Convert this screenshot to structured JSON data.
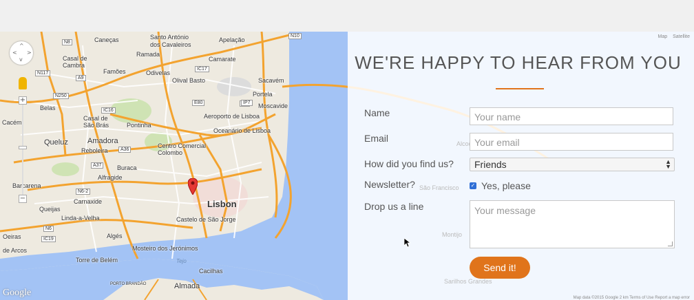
{
  "map": {
    "labels": {
      "santo_antonio": "Santo António",
      "cavaleiros": "dos Cavaleiros",
      "caneças": "Caneças",
      "apelacao": "Apelação",
      "ramada": "Ramada",
      "camarate": "Camarate",
      "casal_cambra": "Casal de",
      "cambra": "Cambra",
      "famoes": "Famões",
      "odivelas": "Odivelas",
      "olival_basto": "Olival Basto",
      "sacavem": "Sacavém",
      "portela": "Portela",
      "belas": "Belas",
      "aeroporto": "Aeroporto de Lisboa",
      "moscavide": "Moscavide",
      "cacem": "Cacém",
      "casal_sao_bras": "Casal de",
      "sao_bras": "São Brás",
      "pontinha": "Pontinha",
      "oceanario": "Oceanário de Lisboa",
      "queluz": "Queluz",
      "amadora": "Amadora",
      "reboleira": "Reboleira",
      "centro_comercial": "Centro Comercial",
      "colombo": "Colombo",
      "buraca": "Buraca",
      "alfragide": "Alfragide",
      "barcarena": "Barcarena",
      "carnaxide": "Carnaxide",
      "lisbon": "Lisbon",
      "queijas": "Queijas",
      "linda_a_velha": "Linda-a-Velha",
      "castelo": "Castelo de São Jorge",
      "oeiras": "Oeiras",
      "algés": "Algés",
      "de_arcos": "de Arcos",
      "mosteiro": "Mosteiro dos Jerónimos",
      "torre_belem": "Torre de Belém",
      "porto_brandao": "PORTO BRANDÃO",
      "almada": "Almada",
      "cacilhas": "Cacilhas",
      "sao_francisco": "São Francisco",
      "montijo": "Montijo",
      "tejo": "Tejo",
      "alcochete": "Alcoch",
      "sao_francisco_overlay": "São Francisco",
      "sarilhos": "Sarilhos Grandes"
    },
    "roads": [
      "N8",
      "A36",
      "IC17",
      "A1",
      "A9",
      "N117",
      "N250",
      "IC16",
      "N117",
      "A37",
      "A5",
      "N6-2",
      "N6-3",
      "N6",
      "IC19",
      "A30",
      "N10",
      "E1",
      "IP7",
      "E80",
      "N249",
      "N249-4",
      "N6-7"
    ],
    "map_type": [
      "Map",
      "Satellite"
    ],
    "google_logo": "Google",
    "attribution": "Map data ©2015 Google   2 km        Terms of Use    Report a map error",
    "pan_arrows": [
      "^",
      "<",
      ">",
      "v"
    ],
    "zoom_in": "+",
    "zoom_out": "−"
  },
  "form": {
    "heading": "WE'RE HAPPY TO HEAR FROM YOU",
    "name_label": "Name",
    "name_placeholder": "Your name",
    "email_label": "Email",
    "email_placeholder": "Your email",
    "found_label": "How did you find us?",
    "found_value": "Friends",
    "newsletter_label": "Newsletter?",
    "newsletter_checked": true,
    "newsletter_option": "Yes, please",
    "message_label": "Drop us a line",
    "message_placeholder": "Your message",
    "submit_label": "Send it!"
  },
  "colors": {
    "accent": "#e0741b",
    "water": "#a3c3f5",
    "land": "#eeeae0",
    "major_road": "#f3a32f",
    "checkbox": "#2f6fd6"
  },
  "icons": {
    "pin": "map-pin-icon",
    "pegman": "pegman-icon",
    "pan": "pan-control-icon",
    "cursor": "mouse-cursor-icon"
  }
}
